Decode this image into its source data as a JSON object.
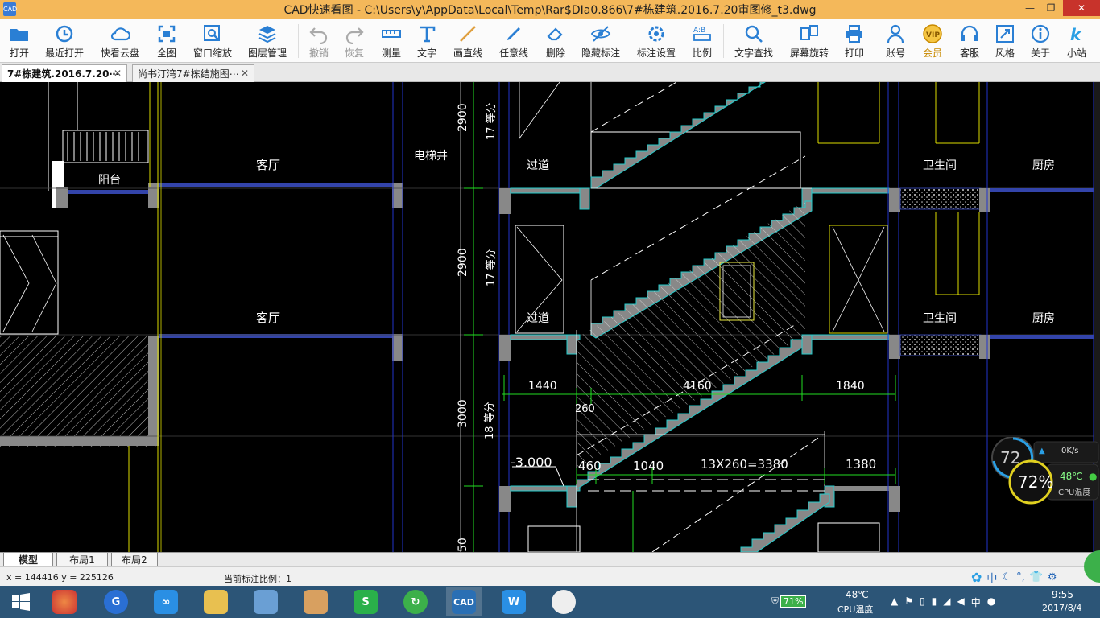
{
  "window": {
    "title": "CAD快速看图 - C:\\Users\\y\\AppData\\Local\\Temp\\Rar$DIa0.866\\7#栋建筑.2016.7.20审图修_t3.dwg",
    "app_icon_text": "CAD"
  },
  "toolbar": {
    "open": "打开",
    "recent": "最近打开",
    "cloud": "快看云盘",
    "fit": "全图",
    "zoom_window": "窗口缩放",
    "layers": "图层管理",
    "undo": "撤销",
    "redo": "恢复",
    "measure": "测量",
    "text": "文字",
    "line": "画直线",
    "freeline": "任意线",
    "erase": "删除",
    "hide_marks": "隐藏标注",
    "mark_settings": "标注设置",
    "scale": "比例",
    "text_find": "文字查找",
    "rotate": "屏幕旋转",
    "print": "打印",
    "account": "账号",
    "vip": "会员",
    "service": "客服",
    "style": "风格",
    "about": "关于",
    "site": "小站"
  },
  "tabs": [
    {
      "label": "7#栋建筑.2016.7.20⋯"
    },
    {
      "label": "尚书汀湾7#栋结施图⋯"
    }
  ],
  "drawing": {
    "rooms": {
      "balcony": "阳台",
      "living1": "客厅",
      "living2": "客厅",
      "elevator": "电梯井",
      "corridor1": "过道",
      "corridor2": "过道",
      "bath1": "卫生间",
      "bath2": "卫生间",
      "kitchen1": "厨房",
      "kitchen2": "厨房"
    },
    "dims": {
      "h1": "2900",
      "h2": "2900",
      "h3": "3000",
      "h4": "50",
      "steps1": "17 等分",
      "steps2": "17 等分",
      "steps3": "18 等分",
      "w1": "1440",
      "w2": "4160",
      "w3": "1840",
      "w_small": "260",
      "elev": "-3.000",
      "b1": "460",
      "b2": "1040",
      "b3": "13X260=3380",
      "b4": "1380"
    }
  },
  "layouts": [
    "模型",
    "布局1",
    "布局2"
  ],
  "status": {
    "coords": "x = 144416  y = 225126",
    "scale": "当前标注比例：1"
  },
  "monitor": {
    "cpu_big": "72",
    "cpu_pct": "72%",
    "net": "0K/s",
    "temp": "48℃",
    "temp_label": "CPU温度"
  },
  "taskbar": {
    "battery": "71%",
    "temp": "48℃",
    "temp_label": "CPU温度",
    "ime": "中",
    "time": "9:55",
    "date": "2017/8/4"
  },
  "ime_bar": {
    "lang": "中"
  }
}
